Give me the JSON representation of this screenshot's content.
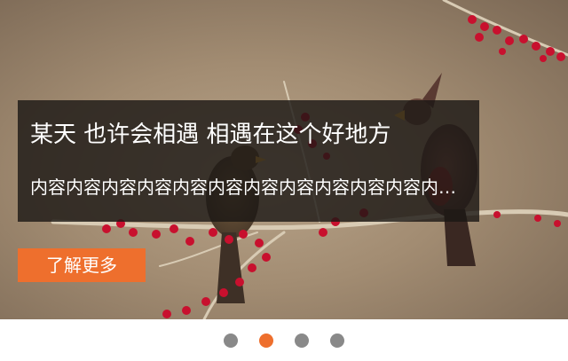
{
  "slide": {
    "title": "某天 也许会相遇 相遇在这个好地方",
    "text": "内容内容内容内容内容内容内容内容内容内容内容内容内容内容内容内容",
    "button_label": "了解更多",
    "image_subject": "two cardinal birds perched on a branch with red berries"
  },
  "pagination": {
    "count": 4,
    "active_index": 1,
    "active_color": "#ee6f2d",
    "inactive_color": "#898989"
  }
}
